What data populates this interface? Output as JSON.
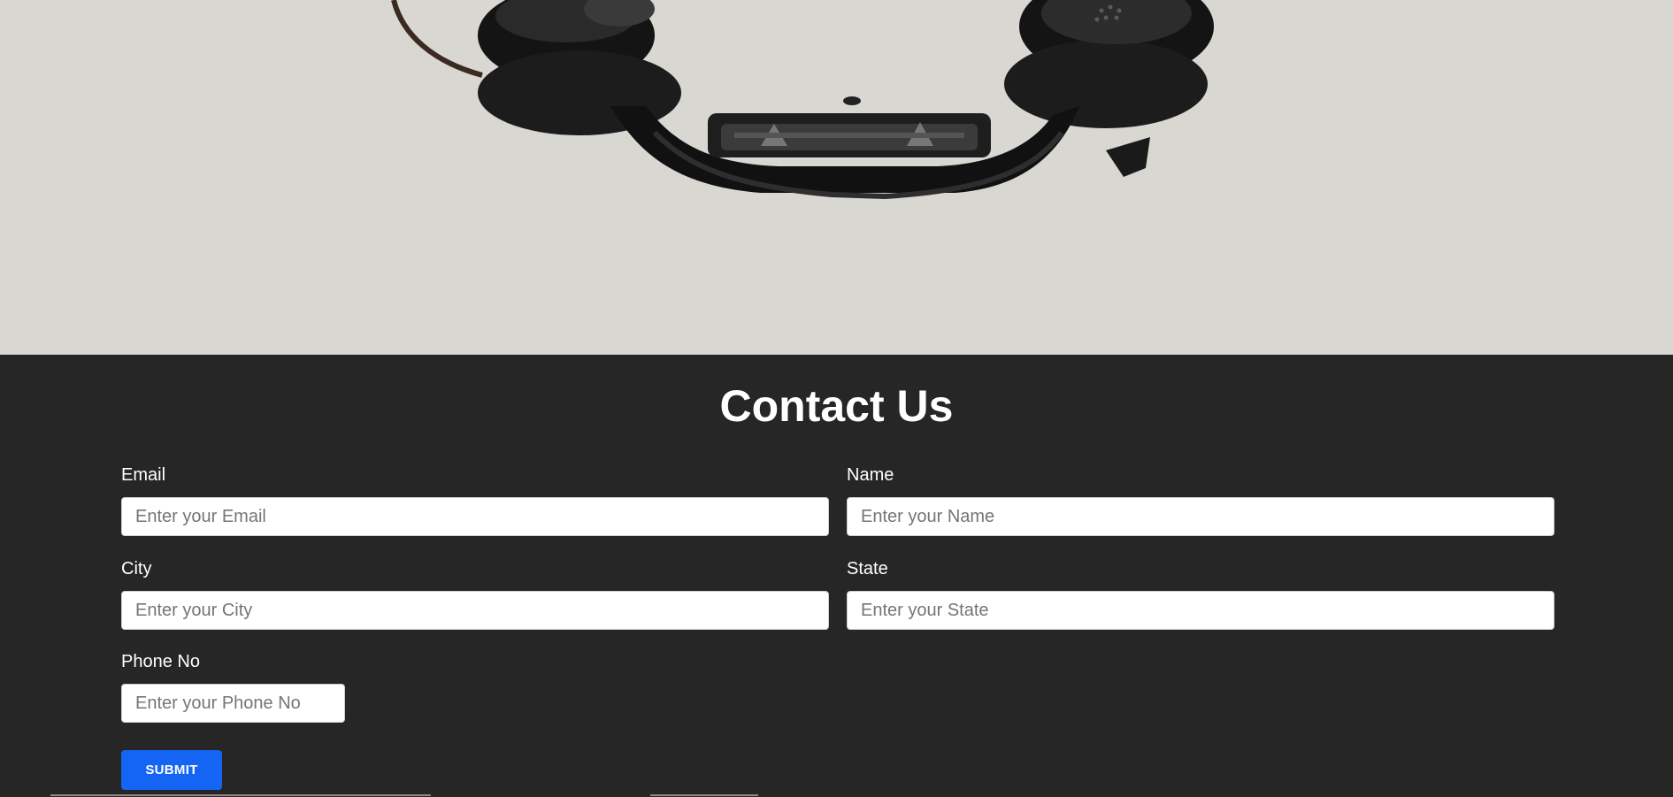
{
  "hero": {
    "image_icon": "vintage-telephone-handset"
  },
  "contact": {
    "title": "Contact Us",
    "fields": {
      "email": {
        "label": "Email",
        "placeholder": "Enter your Email",
        "value": ""
      },
      "name": {
        "label": "Name",
        "placeholder": "Enter your Name",
        "value": ""
      },
      "city": {
        "label": "City",
        "placeholder": "Enter your City",
        "value": ""
      },
      "state": {
        "label": "State",
        "placeholder": "Enter your State",
        "value": ""
      },
      "phone": {
        "label": "Phone No",
        "placeholder": "Enter your Phone No",
        "value": ""
      }
    },
    "submit_label": "SUBMIT"
  },
  "colors": {
    "hero_background": "#d9d7d1",
    "section_background": "#262626",
    "submit_button": "#1565f5",
    "text": "#ffffff"
  }
}
